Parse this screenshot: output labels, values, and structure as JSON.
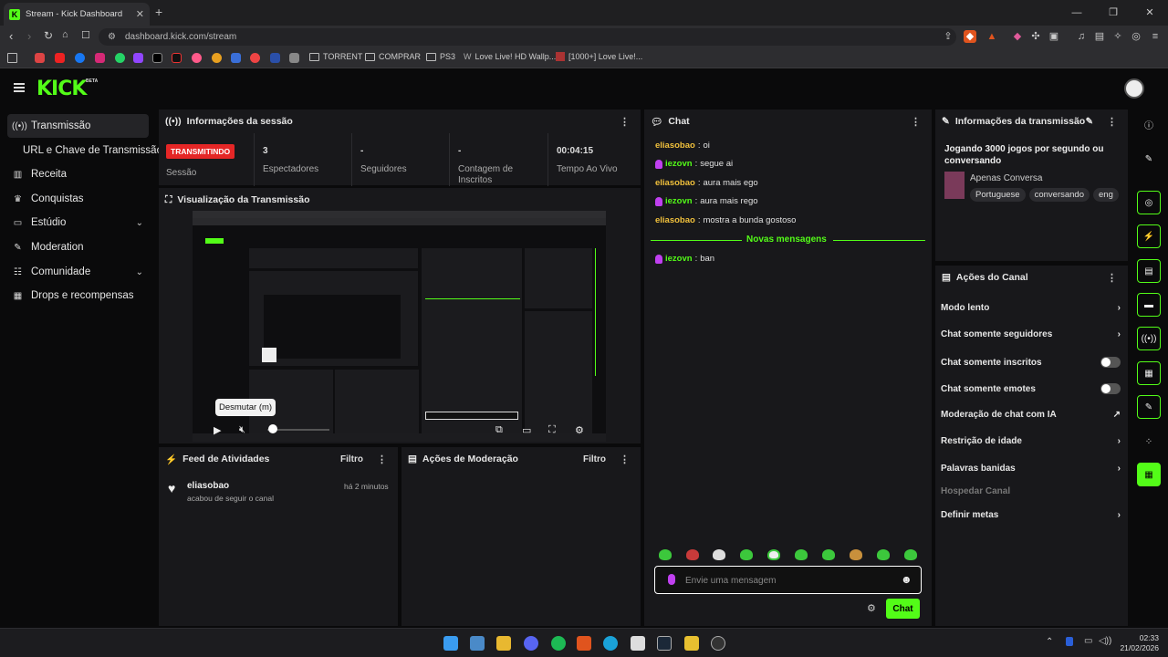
{
  "browser": {
    "tab_title": "Stream - Kick Dashboard",
    "url": "dashboard.kick.com/stream",
    "bookmarks": [
      "TORRENT",
      "COMPRAR",
      "PS3",
      "Love Live! HD Wallp...",
      "[1000+] Love Live!..."
    ]
  },
  "brand": {
    "logo": "KICK",
    "beta": "BETA",
    "accent": "#53fc18",
    "live_red": "#e52626"
  },
  "sidebar": {
    "items": [
      {
        "label": "Transmissão",
        "icon": "broadcast-icon"
      },
      {
        "label": "URL e Chave de Transmissão",
        "icon": ""
      },
      {
        "label": "Receita",
        "icon": "chart-icon"
      },
      {
        "label": "Conquistas",
        "icon": "trophy-icon"
      },
      {
        "label": "Estúdio",
        "icon": "studio-icon"
      },
      {
        "label": "Moderation",
        "icon": "wrench-icon"
      },
      {
        "label": "Comunidade",
        "icon": "community-icon"
      },
      {
        "label": "Drops e recompensas",
        "icon": "gift-icon"
      }
    ]
  },
  "session": {
    "title": "Informações da sessão",
    "live_badge": "TRANSMITINDO",
    "stats": [
      {
        "value": "",
        "label": "Sessão"
      },
      {
        "value": "3",
        "label": "Espectadores"
      },
      {
        "value": "-",
        "label": "Seguidores"
      },
      {
        "value": "-",
        "label": "Contagem de Inscritos"
      },
      {
        "value": "00:04:15",
        "label": "Tempo Ao Vivo"
      }
    ]
  },
  "preview": {
    "title": "Visualização da Transmissão",
    "tooltip": "Desmutar (m)"
  },
  "activity": {
    "title": "Feed de Atividades",
    "filter": "Filtro",
    "items": [
      {
        "user": "eliasobao",
        "text": "acabou de seguir o canal",
        "time": "há 2 minutos"
      }
    ]
  },
  "moderation": {
    "title": "Ações de Moderação",
    "filter": "Filtro"
  },
  "chat": {
    "title": "Chat",
    "messages": [
      {
        "user": "eliasobao",
        "text": "oi",
        "color": "#f0c03c",
        "mic": false
      },
      {
        "user": "iezovn",
        "text": "segue ai",
        "color": "#53fc18",
        "mic": true
      },
      {
        "user": "eliasobao",
        "text": "aura mais ego",
        "color": "#f0c03c",
        "mic": false
      },
      {
        "user": "iezovn",
        "text": "aura mais rego",
        "color": "#53fc18",
        "mic": true
      },
      {
        "user": "eliasobao",
        "text": "mostra a bunda gostoso",
        "color": "#f0c03c",
        "mic": false
      }
    ],
    "new_messages": "Novas mensagens",
    "after": [
      {
        "user": "iezovn",
        "text": "ban",
        "color": "#53fc18",
        "mic": true
      }
    ],
    "placeholder": "Envie uma mensagem",
    "send": "Chat"
  },
  "stream_info": {
    "title": "Informações da transmissão",
    "stream_title": "Jogando 3000 jogos por segundo ou conversando",
    "category": "Apenas Conversa",
    "tags": [
      "Portuguese",
      "conversando",
      "eng"
    ]
  },
  "channel_actions": {
    "title": "Ações do Canal",
    "items": [
      {
        "label": "Modo lento",
        "control": "chevron"
      },
      {
        "label": "Chat somente seguidores",
        "control": "chevron"
      },
      {
        "label": "Chat somente inscritos",
        "control": "toggle"
      },
      {
        "label": "Chat somente emotes",
        "control": "toggle"
      },
      {
        "label": "Moderação de chat com IA",
        "control": "external"
      },
      {
        "label": "Restrição de idade",
        "control": "chevron"
      },
      {
        "label": "Palavras banidas",
        "control": "chevron"
      },
      {
        "label": "Hospedar Canal",
        "control": "disabled"
      },
      {
        "label": "Definir metas",
        "control": "chevron"
      }
    ]
  },
  "taskbar": {
    "time": "02:33",
    "date": "21/02/2026"
  }
}
